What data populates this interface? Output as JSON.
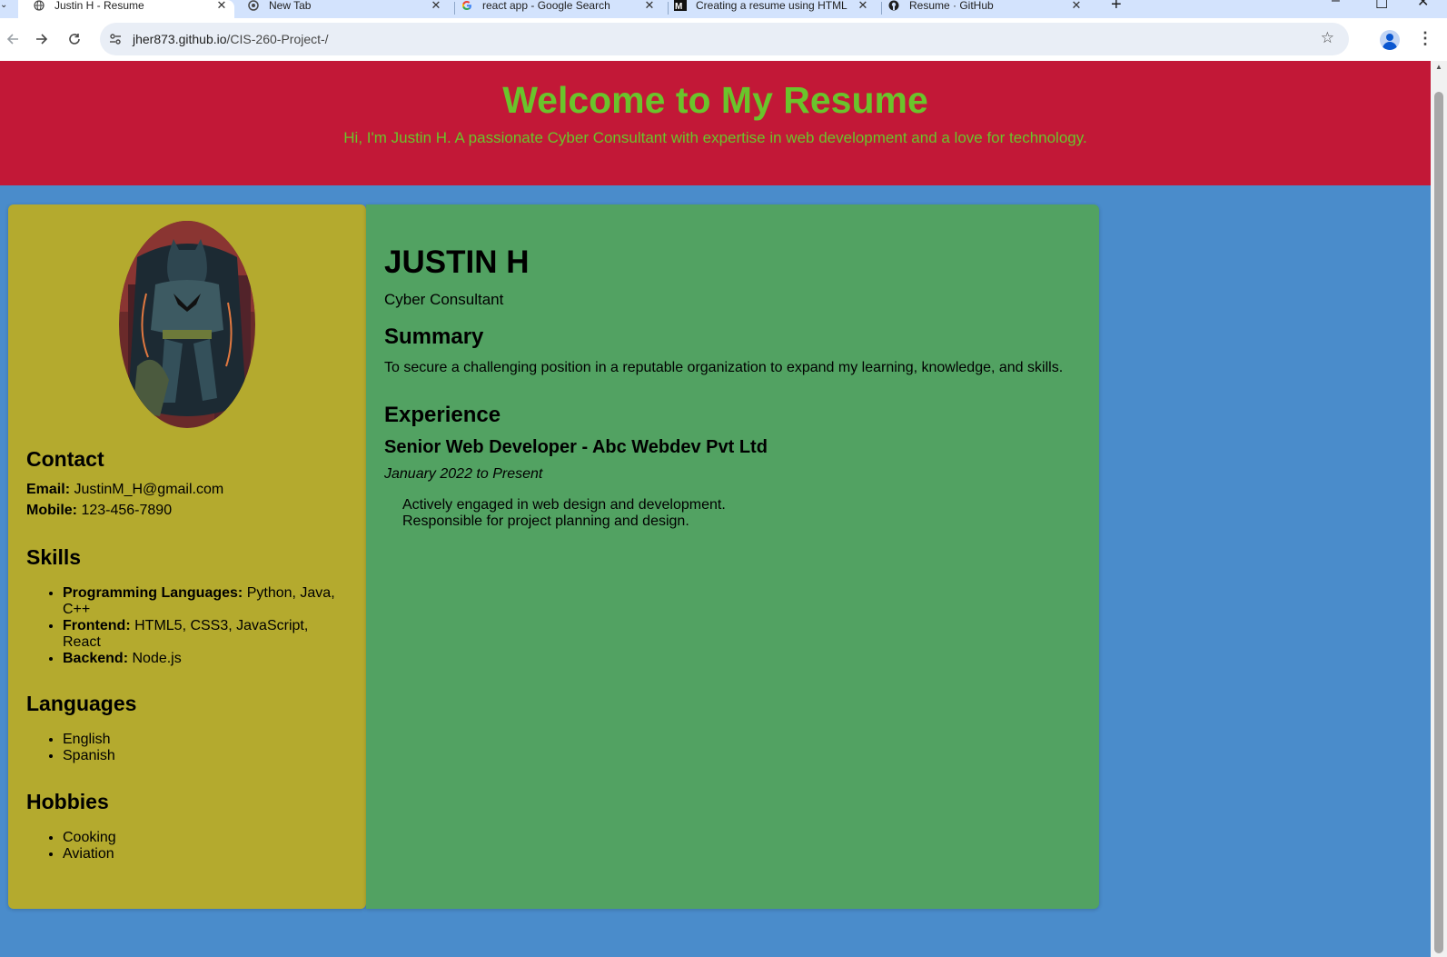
{
  "browser": {
    "tabs": [
      {
        "title": "Justin H - Resume",
        "active": true
      },
      {
        "title": "New Tab",
        "active": false
      },
      {
        "title": "react app - Google Search",
        "active": false
      },
      {
        "title": "Creating a resume using HTML",
        "active": false
      },
      {
        "title": "Resume · GitHub",
        "active": false
      }
    ],
    "url_host": "jher873.github.io",
    "url_path": "/CIS-260-Project-/"
  },
  "hero": {
    "title": "Welcome to My Resume",
    "subtitle": "Hi, I'm Justin H. A passionate Cyber Consultant with expertise in web development and a love for technology."
  },
  "sidebar": {
    "contact_heading": "Contact",
    "email_label": "Email:",
    "email_value": "JustinM_H@gmail.com",
    "mobile_label": "Mobile:",
    "mobile_value": "123-456-7890",
    "skills_heading": "Skills",
    "skills": [
      {
        "label": "Programming Languages:",
        "value": "Python, Java, C++"
      },
      {
        "label": "Frontend:",
        "value": "HTML5, CSS3, JavaScript, React"
      },
      {
        "label": "Backend:",
        "value": "Node.js"
      }
    ],
    "languages_heading": "Languages",
    "languages": [
      "English",
      "Spanish"
    ],
    "hobbies_heading": "Hobbies",
    "hobbies": [
      "Cooking",
      "Aviation"
    ]
  },
  "main": {
    "name": "JUSTIN H",
    "role": "Cyber Consultant",
    "summary_heading": "Summary",
    "summary": "To secure a challenging position in a reputable organization to expand my learning, knowledge, and skills.",
    "experience_heading": "Experience",
    "job_title": "Senior Web Developer - Abc Webdev Pvt Ltd",
    "job_dates": "January 2022 to Present",
    "responsibilities": [
      "Actively engaged in web design and development.",
      "Responsible for project planning and design."
    ]
  },
  "colors": {
    "page_bg": "#4a8ccb",
    "hero_bg": "#c21837",
    "hero_text": "#6ac42b",
    "sidebar_bg": "#b4aa2e",
    "main_bg": "#52a262"
  },
  "icons": {
    "back": "arrow-left-icon",
    "forward": "arrow-right-icon",
    "reload": "reload-icon",
    "bookmark": "star-icon",
    "menu": "kebab-menu-icon"
  }
}
